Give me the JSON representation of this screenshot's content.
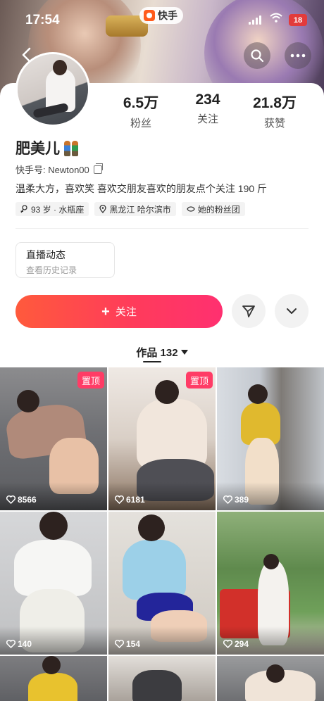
{
  "status_bar": {
    "time": "17:54",
    "app_badge": "快手",
    "battery": "18"
  },
  "profile": {
    "stats": [
      {
        "value": "6.5万",
        "label": "粉丝"
      },
      {
        "value": "234",
        "label": "关注"
      },
      {
        "value": "21.8万",
        "label": "获赞"
      }
    ],
    "name": "肥美儿",
    "kuaishou_id": "快手号: Newton00",
    "bio": "温柔大方，喜欢笑 喜欢交朋友喜欢的朋友点个关注 190 斤",
    "tags": [
      {
        "icon": "female-icon",
        "text": "93 岁 · 水瓶座"
      },
      {
        "icon": "location-icon",
        "text": "黑龙江 哈尔滨市"
      },
      {
        "icon": "fans-group-icon",
        "text": "她的粉丝团"
      }
    ]
  },
  "live": {
    "title": "直播动态",
    "subtitle": "查看历史记录"
  },
  "actions": {
    "follow_label": "关注",
    "follow_color": "#ff3c5a"
  },
  "works": {
    "tab_label": "作品 132",
    "items": [
      {
        "likes": "8566",
        "pinned": "置顶"
      },
      {
        "likes": "6181",
        "pinned": "置顶"
      },
      {
        "likes": "389"
      },
      {
        "likes": "140"
      },
      {
        "likes": "154"
      },
      {
        "likes": "294"
      },
      {},
      {},
      {}
    ]
  }
}
